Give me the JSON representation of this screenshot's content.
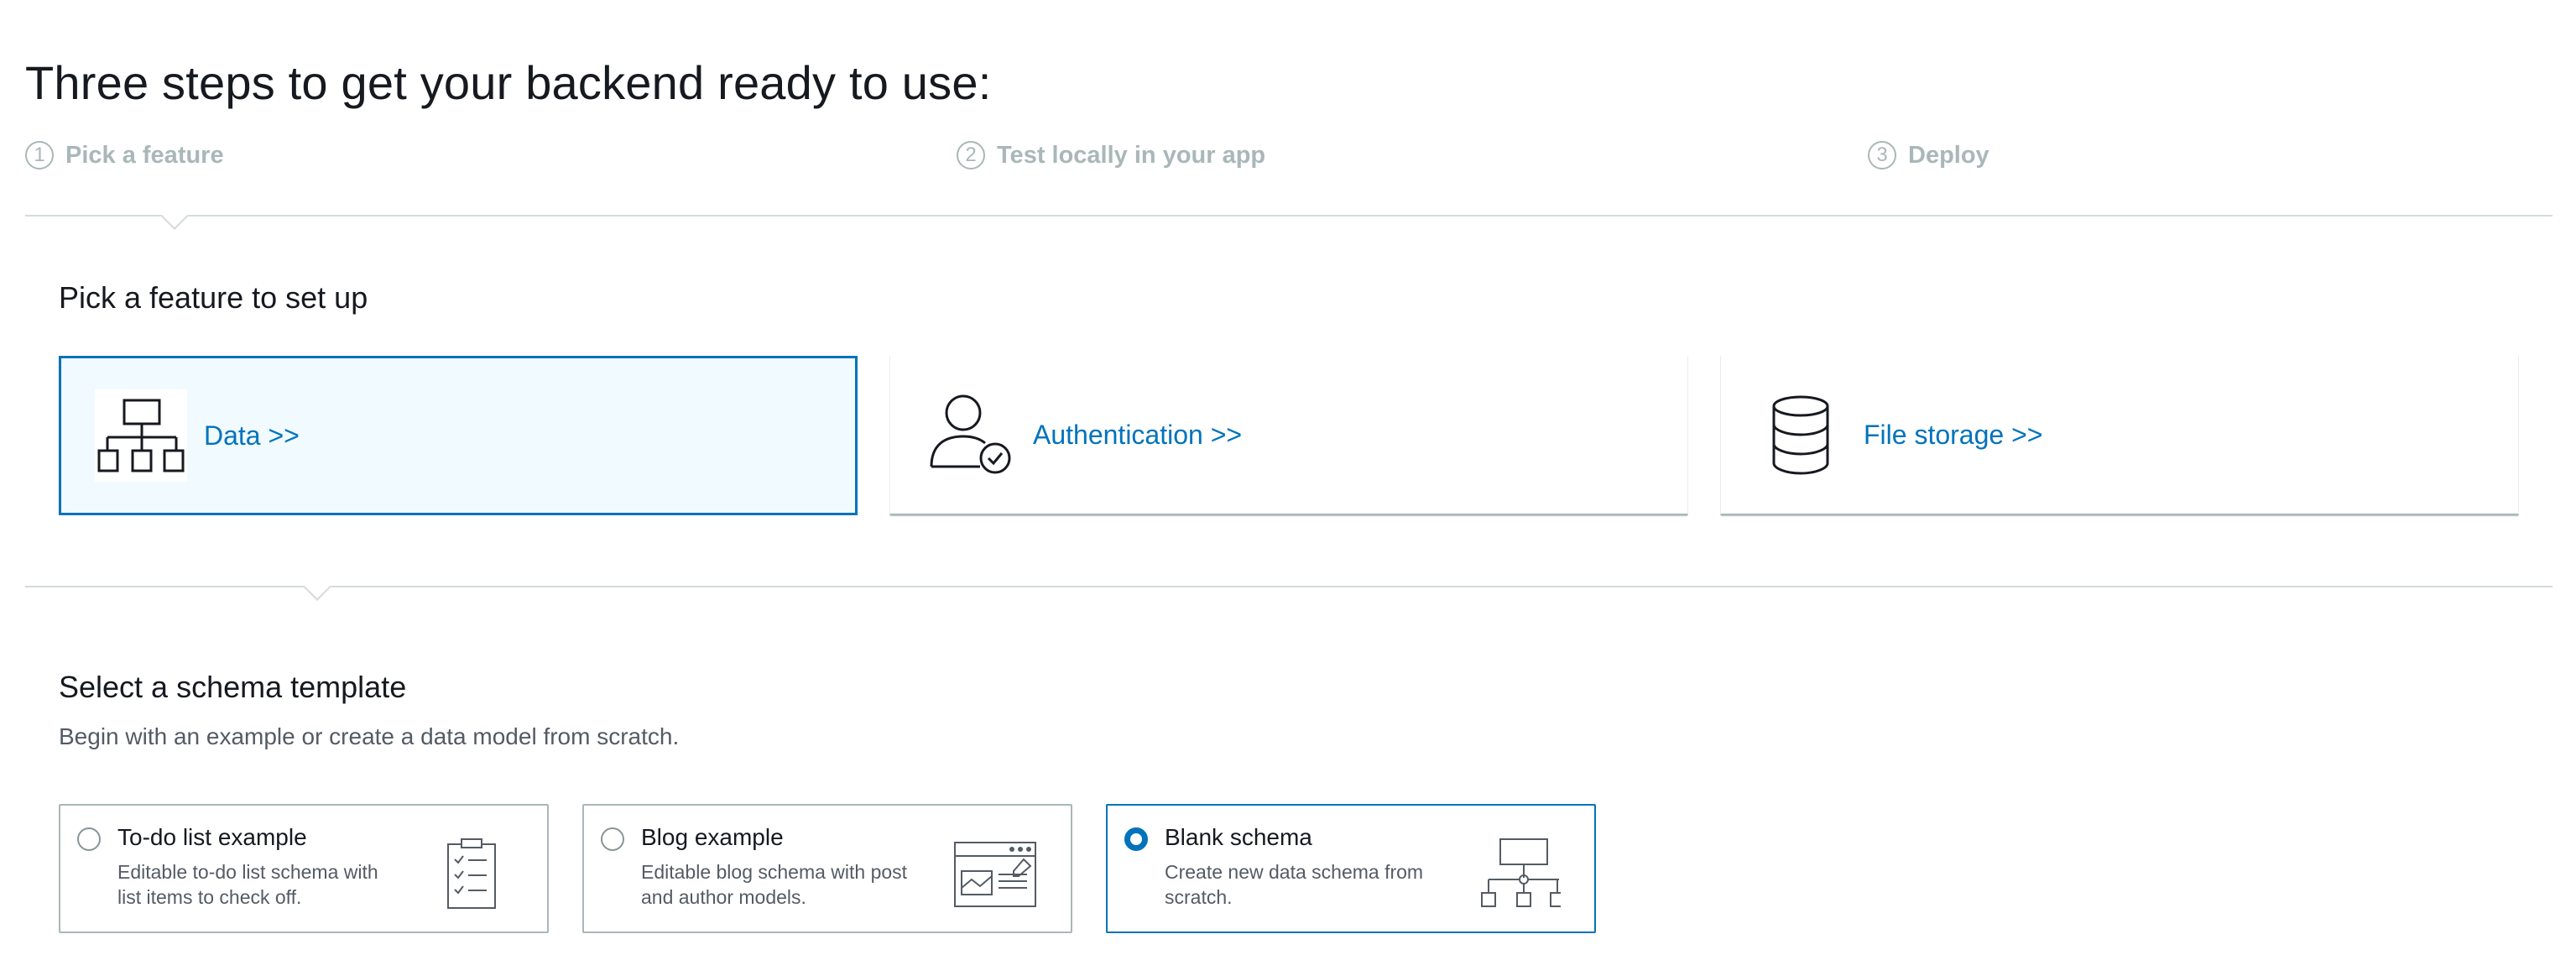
{
  "page": {
    "title": "Three steps to get your backend ready to use:"
  },
  "steps": [
    {
      "number": "1",
      "label": "Pick a feature"
    },
    {
      "number": "2",
      "label": "Test locally in your app"
    },
    {
      "number": "3",
      "label": "Deploy"
    }
  ],
  "feature_section": {
    "title": "Pick a feature to set up",
    "cards": [
      {
        "label": "Data >>",
        "icon": "hierarchy-icon",
        "selected": true
      },
      {
        "label": "Authentication >>",
        "icon": "user-check-icon",
        "selected": false
      },
      {
        "label": "File storage >>",
        "icon": "database-icon",
        "selected": false
      }
    ]
  },
  "schema_section": {
    "title": "Select a schema template",
    "description": "Begin with an example or create a data model from scratch.",
    "templates": [
      {
        "title": "To-do list example",
        "description": "Editable to-do list schema with list items to check off.",
        "icon": "clipboard-checklist-icon",
        "selected": false
      },
      {
        "title": "Blog example",
        "description": "Editable blog schema with post and author models.",
        "icon": "browser-window-icon",
        "selected": false
      },
      {
        "title": "Blank schema",
        "description": "Create new data schema from scratch.",
        "icon": "schema-tree-icon",
        "selected": true
      }
    ]
  },
  "colors": {
    "accent": "#0073bb",
    "selected_background": "#f1faff",
    "muted": "#aab7b8",
    "text": "#16191f",
    "secondary_text": "#545b64"
  }
}
